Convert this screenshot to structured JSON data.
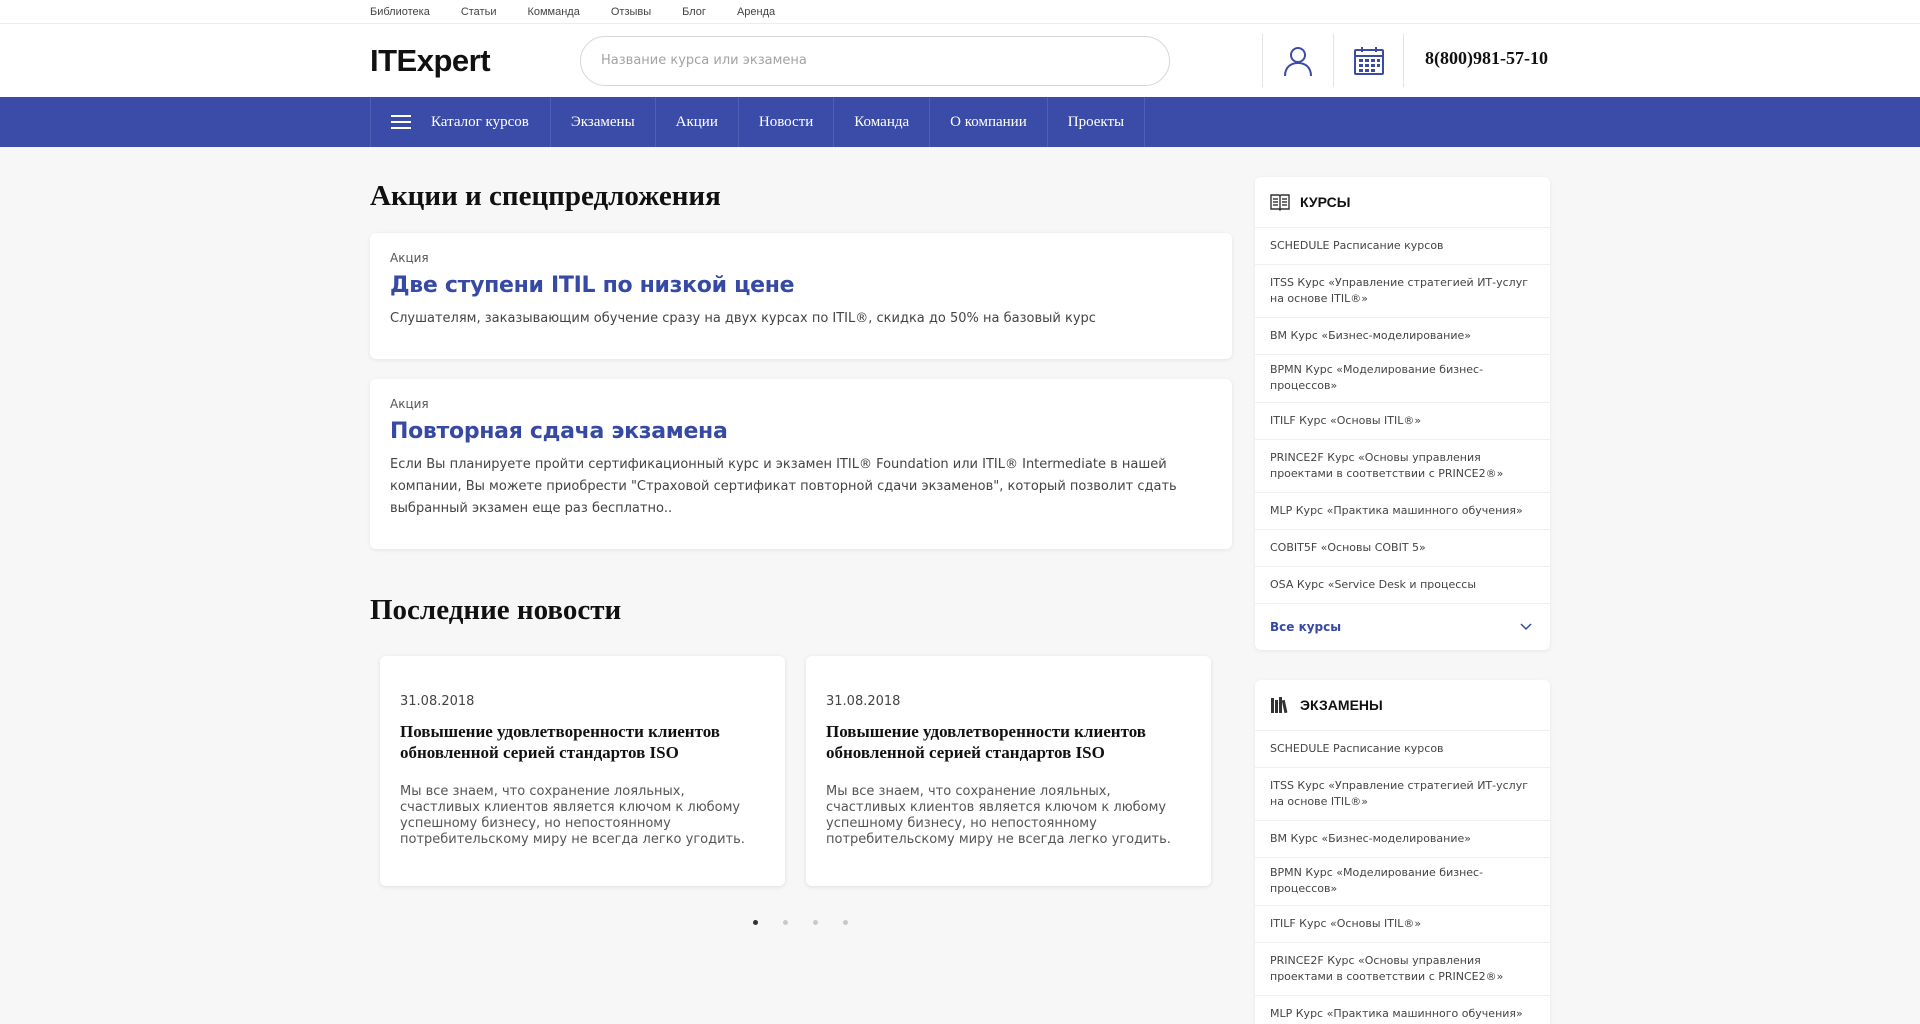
{
  "topbar": {
    "links": [
      "Библиотека",
      "Статьи",
      "Комманда",
      "Отзывы",
      "Блог",
      "Аренда"
    ]
  },
  "header": {
    "logo": "ITExpert",
    "search_placeholder": "Название курса или экзамена",
    "phone": "8(800)981-57-10",
    "icons": [
      "user-icon",
      "calendar-icon"
    ]
  },
  "nav": {
    "items": [
      "Каталог курсов",
      "Экзамены",
      "Акции",
      "Новости",
      "Команда",
      "О компании",
      "Проекты"
    ]
  },
  "promos": {
    "heading": "Акции и спецпредложения",
    "items": [
      {
        "tag": "Акция",
        "title": "Две ступени ITIL по низкой цене",
        "desc": "Слушателям, заказывающим обучение сразу на двух курсах по ITIL®, скидка до 50% на базовый курс"
      },
      {
        "tag": "Акция",
        "title": "Повторная сдача экзамена",
        "desc": "Если Вы планируете пройти сертификационный курс и экзамен ITIL® Foundation или ITIL® Intermediate в нашей компании, Вы можете приобрести \"Страховой сертификат повторной сдачи экзаменов\", который позволит сдать выбранный экзамен еще раз бесплатно.."
      }
    ]
  },
  "news": {
    "heading": "Последние новости",
    "items": [
      {
        "date": "31.08.2018",
        "title": "Повышение удовлетворенности клиентов обновленной серией стандартов ISO",
        "text": "Мы все знаем, что сохранение лояльных, счастливых клиентов является ключом к любому успешному бизнесу, но непостоянному потребительскому миру не всегда легко угодить."
      },
      {
        "date": "31.08.2018",
        "title": "Повышение удовлетворенности клиентов обновленной серией стандартов ISO",
        "text": "Мы все знаем, что сохранение лояльных, счастливых клиентов является ключом к любому успешному бизнесу, но непостоянному потребительскому миру не всегда легко угодить."
      }
    ],
    "pager": {
      "total": 4,
      "active": 1
    }
  },
  "sidebar": {
    "courses": {
      "title": "КУРСЫ",
      "items": [
        "SCHEDULE Расписание курсов",
        "ITSS Курс «Управление стратегией ИТ-услуг на основе ITIL®»",
        "BM Курс «Бизнес-моделирование»",
        "BPMN Курс «Моделирование бизнес-процессов»",
        "ITILF Курс «Основы ITIL®»",
        "PRINCE2F Курс «Основы управления проектами в соответствии с PRINCE2®»",
        "MLP Курс «Практика машинного обучения»",
        "COBIT5F «Основы COBIT 5»",
        "OSA Курс «Service Desk и процессы"
      ],
      "all_label": "Все курсы"
    },
    "exams": {
      "title": "ЭКЗАМЕНЫ",
      "items": [
        "SCHEDULE Расписание курсов",
        "ITSS Курс «Управление стратегией ИТ-услуг на основе ITIL®»",
        "BM Курс «Бизнес-моделирование»",
        "BPMN Курс «Моделирование бизнес-процессов»",
        "ITILF Курс «Основы ITIL®»",
        "PRINCE2F Курс «Основы управления проектами в соответствии с PRINCE2®»",
        "MLP Курс «Практика машинного обучения»"
      ]
    }
  },
  "colors": {
    "brand": "#3b4ca8",
    "link": "#3549a5"
  }
}
